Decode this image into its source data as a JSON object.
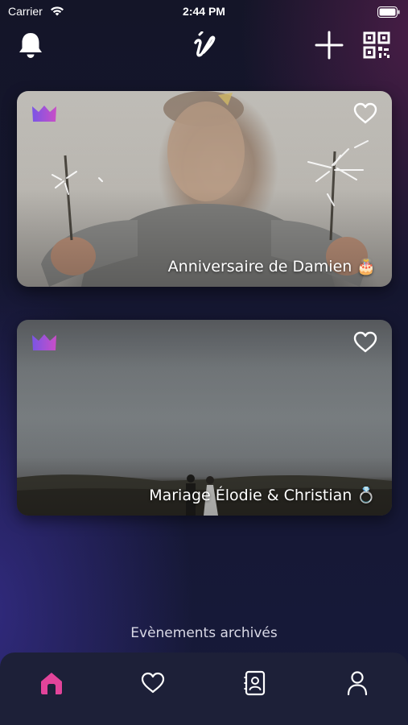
{
  "status_bar": {
    "carrier": "Carrier",
    "time": "2:44 PM"
  },
  "header": {
    "icons": [
      "bell-icon",
      "app-logo",
      "plus-icon",
      "qr-code-icon"
    ]
  },
  "events": [
    {
      "title": "Anniversaire de Damien 🎂",
      "badge_icon": "crown-icon",
      "favorite": false
    },
    {
      "title": "Mariage Élodie & Christian 💍",
      "badge_icon": "crown-icon",
      "favorite": false
    }
  ],
  "archived_label": "Evènements archivés",
  "tab_bar": {
    "tabs": [
      "home-icon",
      "heart-icon",
      "contacts-icon",
      "profile-icon"
    ],
    "active_index": 0,
    "active_color": "#e2449a"
  },
  "colors": {
    "accent": "#e2449a",
    "crown_start": "#7a55e6",
    "crown_end": "#c94ec7"
  }
}
